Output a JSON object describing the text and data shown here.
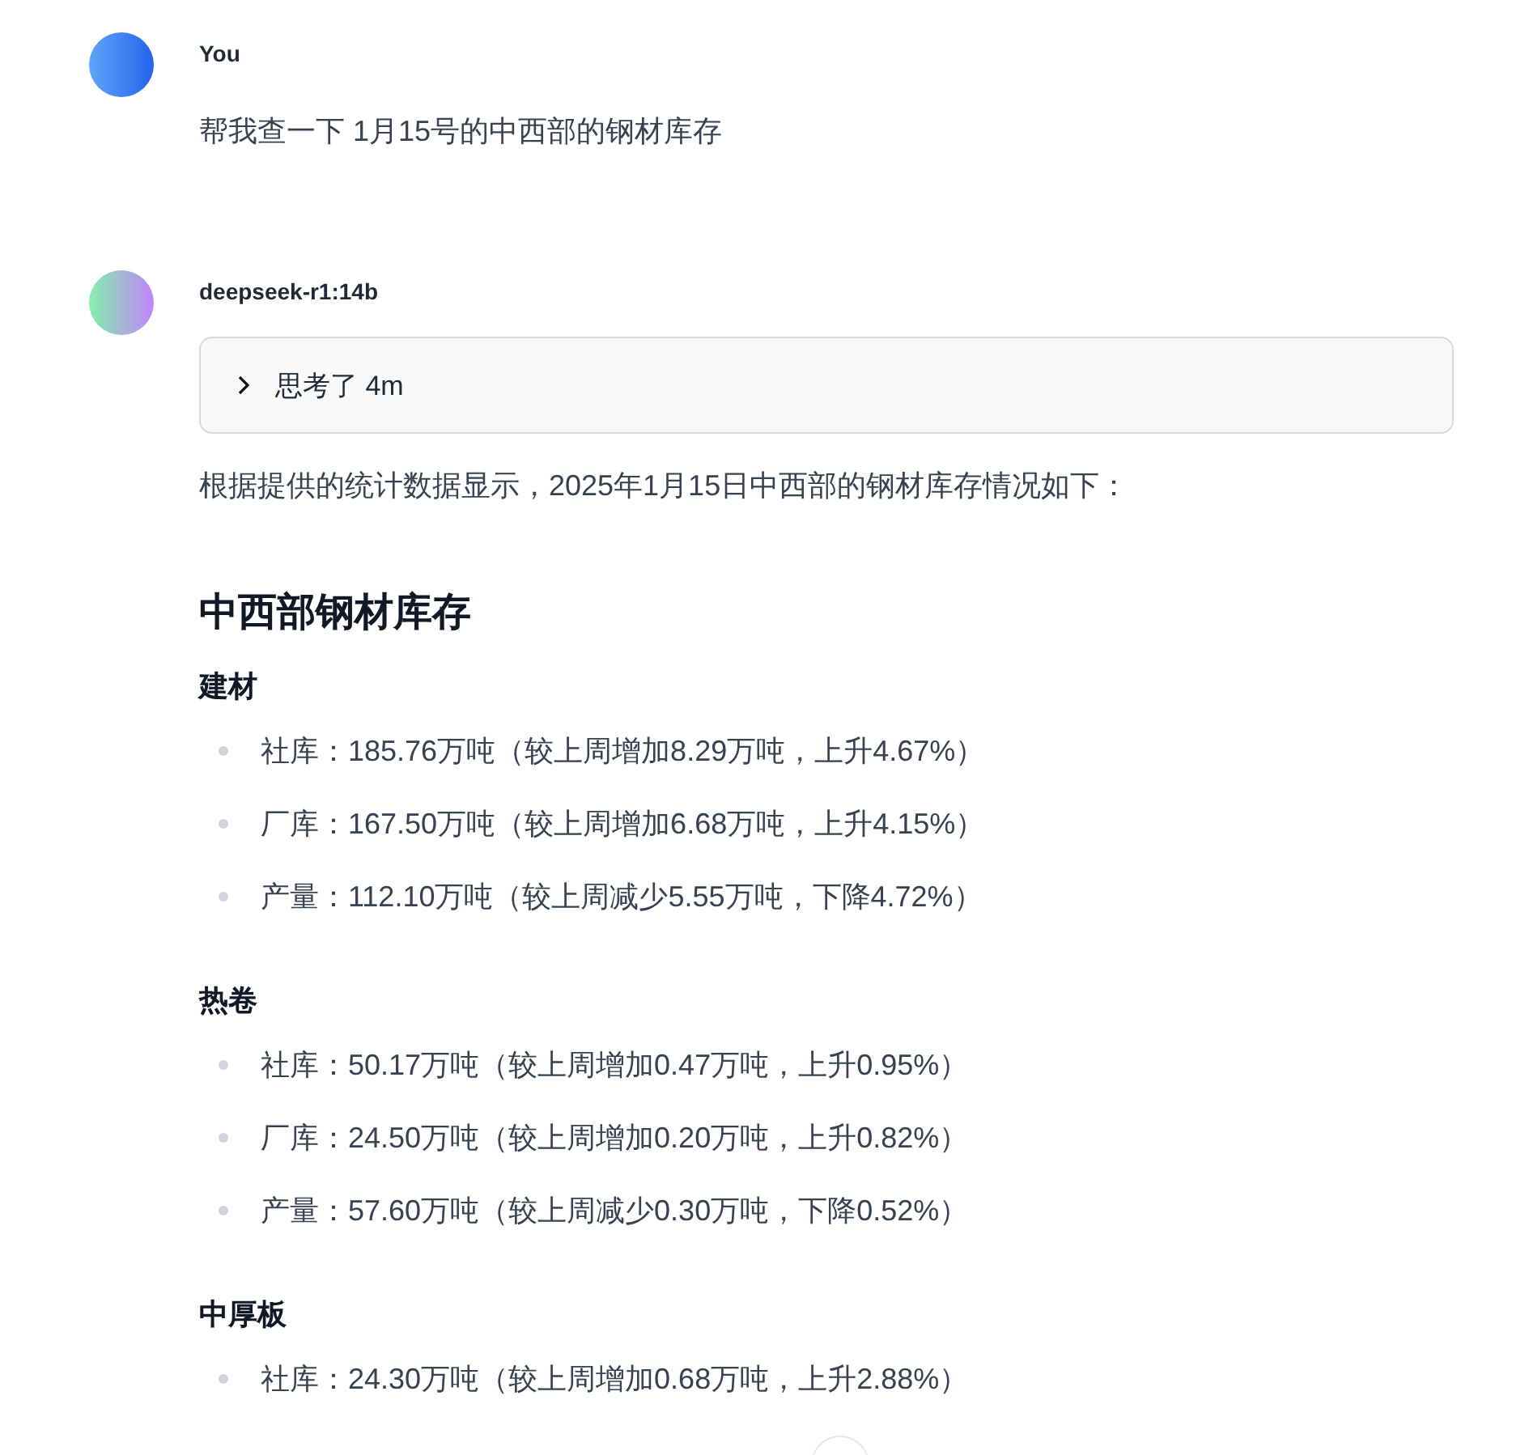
{
  "messages": [
    {
      "kind": "user",
      "author": "You",
      "text": "帮我查一下 1月15号的中西部的钢材库存"
    },
    {
      "kind": "assistant",
      "author": "deepseek-r1:14b",
      "thinking": {
        "label": "思考了 4m",
        "expanded": false
      },
      "intro": "根据提供的统计数据显示，2025年1月15日中西部的钢材库存情况如下：",
      "heading": "中西部钢材库存",
      "sections": [
        {
          "title": "建材",
          "items": [
            "社库：185.76万吨（较上周增加8.29万吨，上升4.67%）",
            "厂库：167.50万吨（较上周增加6.68万吨，上升4.15%）",
            "产量：112.10万吨（较上周减少5.55万吨，下降4.72%）"
          ]
        },
        {
          "title": "热卷",
          "items": [
            "社库：50.17万吨（较上周增加0.47万吨，上升0.95%）",
            "厂库：24.50万吨（较上周增加0.20万吨，上升0.82%）",
            "产量：57.60万吨（较上周减少0.30万吨，下降0.52%）"
          ]
        },
        {
          "title": "中厚板",
          "items": [
            "社库：24.30万吨（较上周增加0.68万吨，上升2.88%）"
          ]
        }
      ]
    }
  ]
}
